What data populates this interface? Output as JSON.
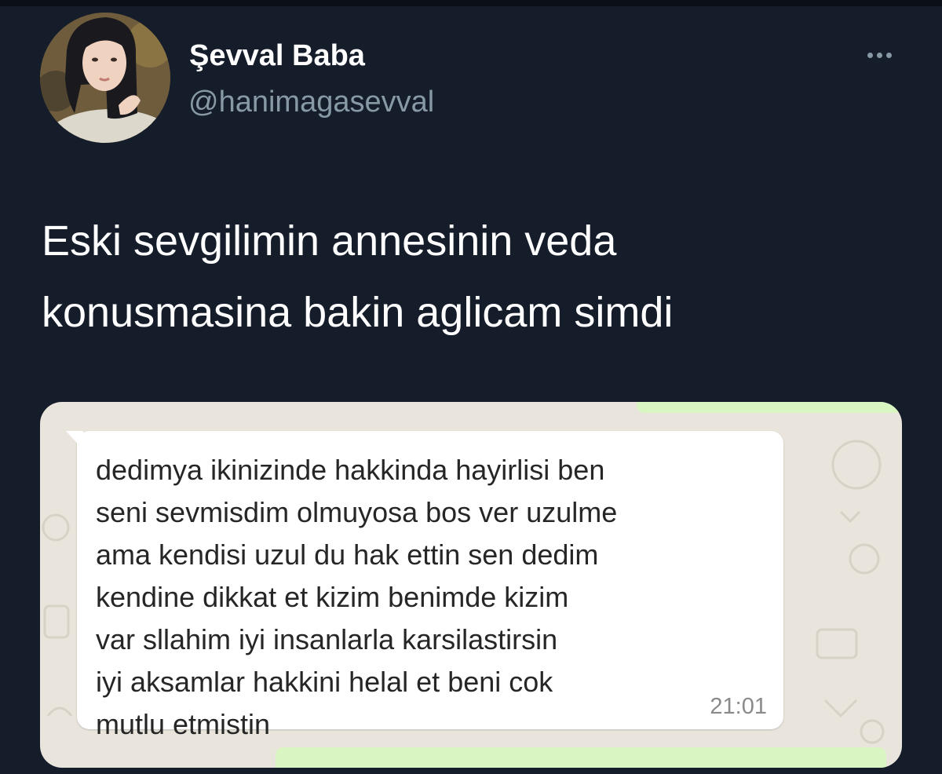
{
  "tweet": {
    "author": {
      "display_name": "Şevval Baba",
      "handle": "@hanimagasevval"
    },
    "more_icon": "more-horizontal-icon",
    "text_lines": [
      "Eski sevgilimin annesinin veda",
      "konusmasina bakin aglicam simdi"
    ],
    "media": {
      "message_lines": [
        "dedimya ikinizinde hakkinda hayirlisi ben",
        "seni sevmisdim olmuyosa bos ver uzulme",
        "ama kendisi uzul du hak ettin sen dedim",
        "kendine dikkat et kizim benimde kizim",
        "var sllahim iyi insanlarla karsilastirsin",
        "iyi aksamlar hakkini helal et beni cok",
        "mutlu etmistin"
      ],
      "message_time": "21:01"
    }
  },
  "colors": {
    "background": "#151c2a",
    "text_primary": "#ffffff",
    "text_secondary": "#8899a6",
    "bubble_incoming": "#ffffff",
    "bubble_outgoing": "#d9f6c2",
    "chat_wallpaper": "#e9e5dc"
  }
}
